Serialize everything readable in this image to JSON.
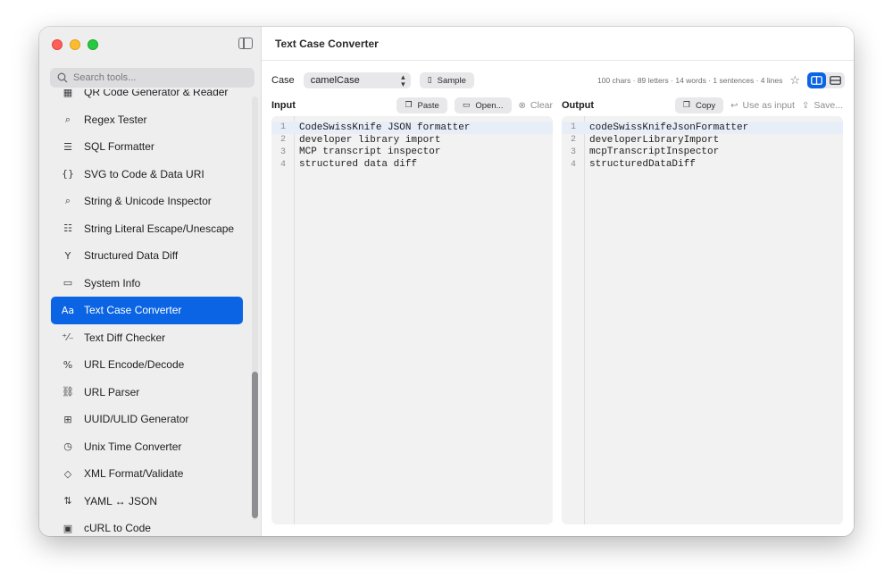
{
  "window": {
    "title": "Text Case Converter"
  },
  "sidebar": {
    "search_placeholder": "Search tools...",
    "items": [
      {
        "label": "QR Code Generator & Reader",
        "icon": "qr-icon"
      },
      {
        "label": "Regex Tester",
        "icon": "magnifier-icon"
      },
      {
        "label": "SQL Formatter",
        "icon": "text-lines-icon"
      },
      {
        "label": "SVG to Code & Data URI",
        "icon": "braces-icon"
      },
      {
        "label": "String & Unicode Inspector",
        "icon": "magnifier-icon"
      },
      {
        "label": "String Literal Escape/Unescape",
        "icon": "escape-icon"
      },
      {
        "label": "Structured Data Diff",
        "icon": "merge-icon"
      },
      {
        "label": "System Info",
        "icon": "display-icon"
      },
      {
        "label": "Text Case Converter",
        "icon": "aa-icon",
        "selected": true
      },
      {
        "label": "Text Diff Checker",
        "icon": "plus-minus-icon"
      },
      {
        "label": "URL Encode/Decode",
        "icon": "percent-icon"
      },
      {
        "label": "URL Parser",
        "icon": "link-icon"
      },
      {
        "label": "UUID/ULID Generator",
        "icon": "hash-icon"
      },
      {
        "label": "Unix Time Converter",
        "icon": "clock-icon"
      },
      {
        "label": "XML Format/Validate",
        "icon": "tag-icon"
      },
      {
        "label": "YAML ↔ JSON",
        "icon": "swap-icon"
      },
      {
        "label": "cURL to Code",
        "icon": "terminal-icon"
      }
    ]
  },
  "toolbar": {
    "case_label": "Case",
    "case_value": "camelCase",
    "sample_label": "Sample",
    "stats": "100 chars · 89 letters · 14 words · 1 sentences · 4 lines"
  },
  "input": {
    "title": "Input",
    "paste_label": "Paste",
    "open_label": "Open...",
    "clear_label": "Clear",
    "lines": [
      {
        "n": "1",
        "text": "CodeSwissKnife JSON formatter"
      },
      {
        "n": "2",
        "text": "developer library import"
      },
      {
        "n": "3",
        "text": "MCP transcript inspector"
      },
      {
        "n": "4",
        "text": "structured data diff"
      }
    ]
  },
  "output": {
    "title": "Output",
    "copy_label": "Copy",
    "use_label": "Use as input",
    "save_label": "Save...",
    "lines": [
      {
        "n": "1",
        "text": "codeSwissKnifeJsonFormatter"
      },
      {
        "n": "2",
        "text": "developerLibraryImport"
      },
      {
        "n": "3",
        "text": "mcpTranscriptInspector"
      },
      {
        "n": "4",
        "text": "structuredDataDiff"
      }
    ]
  },
  "colors": {
    "accent": "#0a64e4",
    "sidebar_bg": "#eeeeef",
    "editor_bg": "#f2f2f3"
  }
}
